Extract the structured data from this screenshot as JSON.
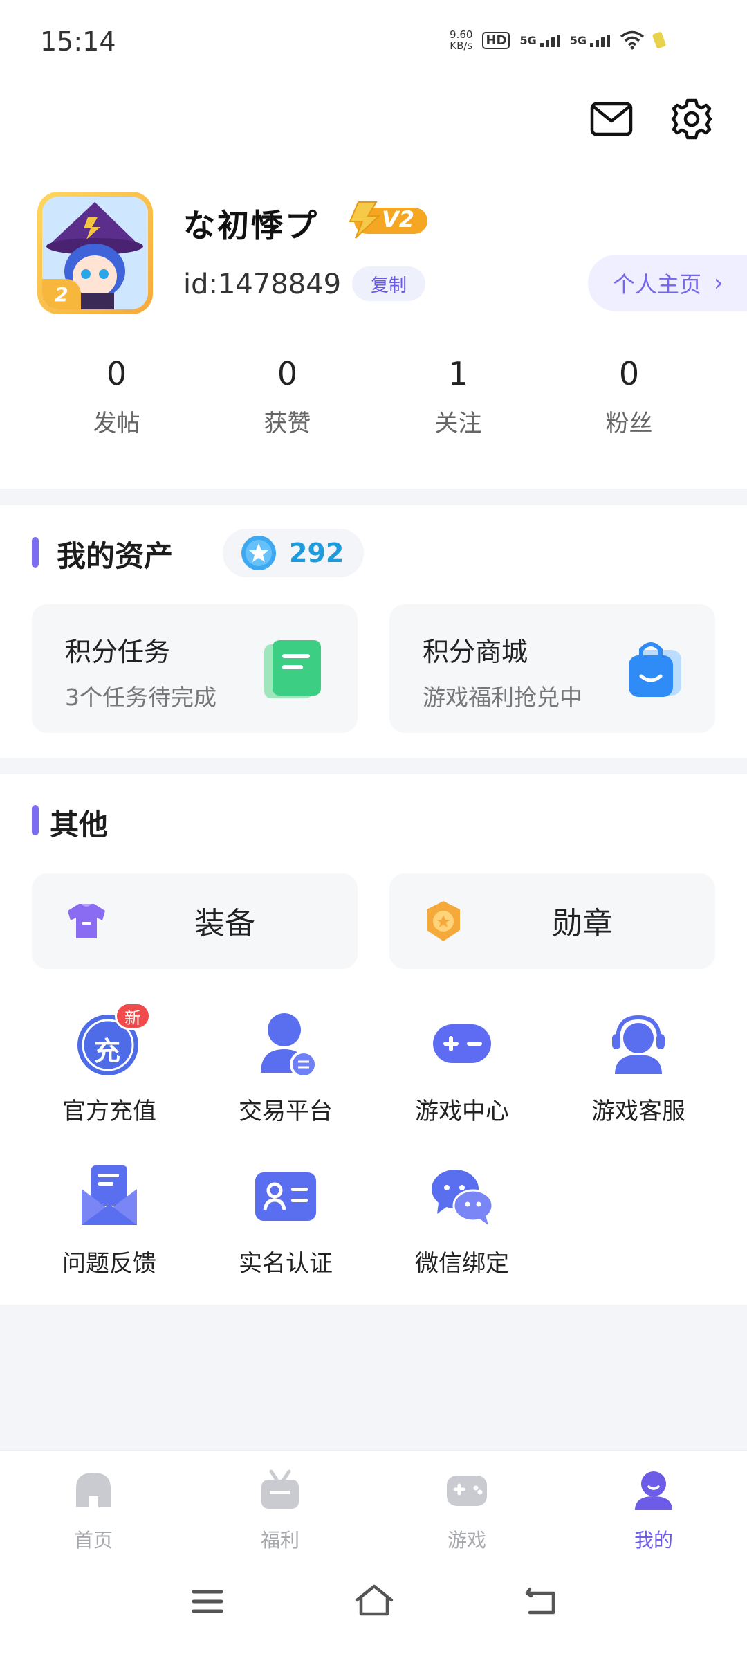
{
  "status_bar": {
    "time": "15:14",
    "net_speed_value": "9.60",
    "net_speed_unit": "KB/s",
    "hd_label": "HD",
    "sim1_label": "5G",
    "sim2_label": "5G"
  },
  "header": {
    "mail_icon": "mail-icon",
    "settings_icon": "gear-icon"
  },
  "profile": {
    "username": "な初悸プ",
    "vip_level": "V2",
    "avatar_level": "2",
    "id_text": "id:1478849",
    "copy_label": "复制",
    "homepage_label": "个人主页"
  },
  "stats": [
    {
      "value": "0",
      "label": "发帖"
    },
    {
      "value": "0",
      "label": "获赞"
    },
    {
      "value": "1",
      "label": "关注"
    },
    {
      "value": "0",
      "label": "粉丝"
    }
  ],
  "assets": {
    "title": "我的资产",
    "points": "292",
    "cards": [
      {
        "title": "积分任务",
        "subtitle": "3个任务待完成",
        "icon": "task-document-icon"
      },
      {
        "title": "积分商城",
        "subtitle": "游戏福利抢兑中",
        "icon": "shopping-bag-icon"
      }
    ]
  },
  "other": {
    "title": "其他",
    "equip": [
      {
        "label": "装备",
        "icon": "tshirt-icon"
      },
      {
        "label": "勋章",
        "icon": "medal-icon"
      }
    ],
    "grid": [
      {
        "label": "官方充值",
        "icon": "recharge-icon",
        "badge": "新",
        "glyph": "充"
      },
      {
        "label": "交易平台",
        "icon": "trade-user-icon"
      },
      {
        "label": "游戏中心",
        "icon": "gamepad-icon"
      },
      {
        "label": "游戏客服",
        "icon": "headset-service-icon"
      },
      {
        "label": "问题反馈",
        "icon": "feedback-envelope-icon"
      },
      {
        "label": "实名认证",
        "icon": "id-card-icon"
      },
      {
        "label": "微信绑定",
        "icon": "wechat-icon"
      }
    ]
  },
  "nav": [
    {
      "label": "首页",
      "icon": "home-icon",
      "active": false
    },
    {
      "label": "福利",
      "icon": "gift-tv-icon",
      "active": false
    },
    {
      "label": "游戏",
      "icon": "gamepad-icon",
      "active": false
    },
    {
      "label": "我的",
      "icon": "profile-icon",
      "active": true
    }
  ],
  "colors": {
    "accent": "#6c5ce7",
    "points_blue": "#1e9bdc",
    "badge_red": "#f04a4a",
    "vip_gold": "#f5a623"
  }
}
